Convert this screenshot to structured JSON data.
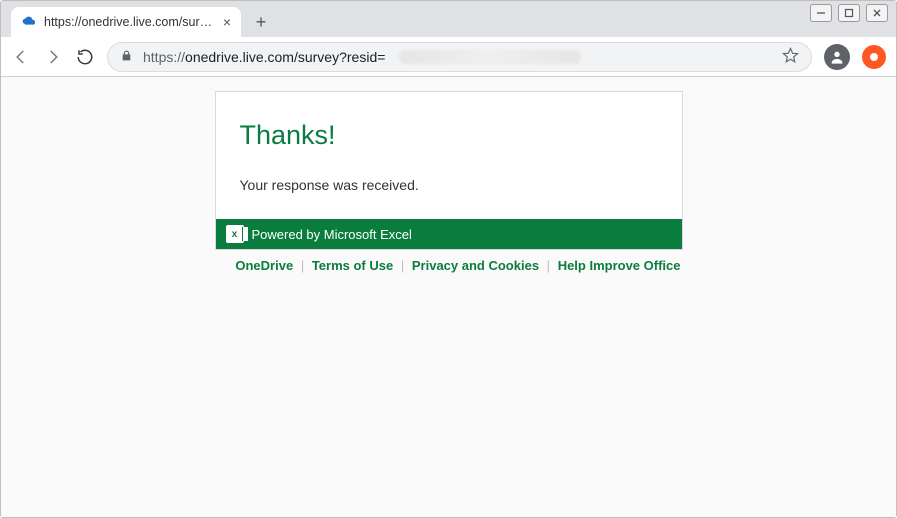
{
  "window": {
    "tab_title": "https://onedrive.live.com/survey?"
  },
  "toolbar": {
    "url_prefix": "https://",
    "url_main": "onedrive.live.com/survey?resid="
  },
  "card": {
    "heading": "Thanks!",
    "message": "Your response was received.",
    "footer": "Powered by Microsoft Excel"
  },
  "links": {
    "onedrive": "OneDrive",
    "terms": "Terms of Use",
    "privacy": "Privacy and Cookies",
    "improve": "Help Improve Office"
  }
}
